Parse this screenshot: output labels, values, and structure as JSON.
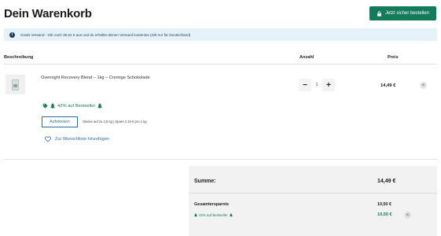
{
  "page": {
    "title": "Dein Warenkorb"
  },
  "header": {
    "checkout_label": "Jetzt sicher bestellen"
  },
  "banner": {
    "text": "Gratis Versand - Gib noch 35,51 € aus und du erhältst deinen Versand kostenlos (Gilt nur für Deutschland)"
  },
  "columns": {
    "description": "Beschreibung",
    "quantity": "Anzahl",
    "price": "Preis"
  },
  "item": {
    "name": "Overnight Recovery Blend – 1kg – Cremige Schokolade",
    "quantity": "1",
    "price": "14,49 €",
    "promo": "42% auf Bestseller",
    "upsell_button": "Aufstocken",
    "upsell_text": "Stocke auf zu 2,5 kg | Spare 2,19 € pro 1 kg",
    "wishlist": "Zur Wunschliste hinzufügen"
  },
  "summary": {
    "total_label": "Summe:",
    "total_value": "14,49 €",
    "savings_label": "Gesamtersparnis",
    "savings_value": "10,50 €",
    "discount_label": "42% auf Bestseller",
    "discount_value": "10,50 €"
  },
  "icons": {
    "info": "info-icon",
    "lock": "lock-icon",
    "tag": "tag-icon",
    "tree": "tree-icon",
    "heart": "heart-icon",
    "close": "close-icon"
  },
  "colors": {
    "accent": "#137a5a",
    "link": "#2e6da4",
    "banner": "#e6f2fa"
  }
}
